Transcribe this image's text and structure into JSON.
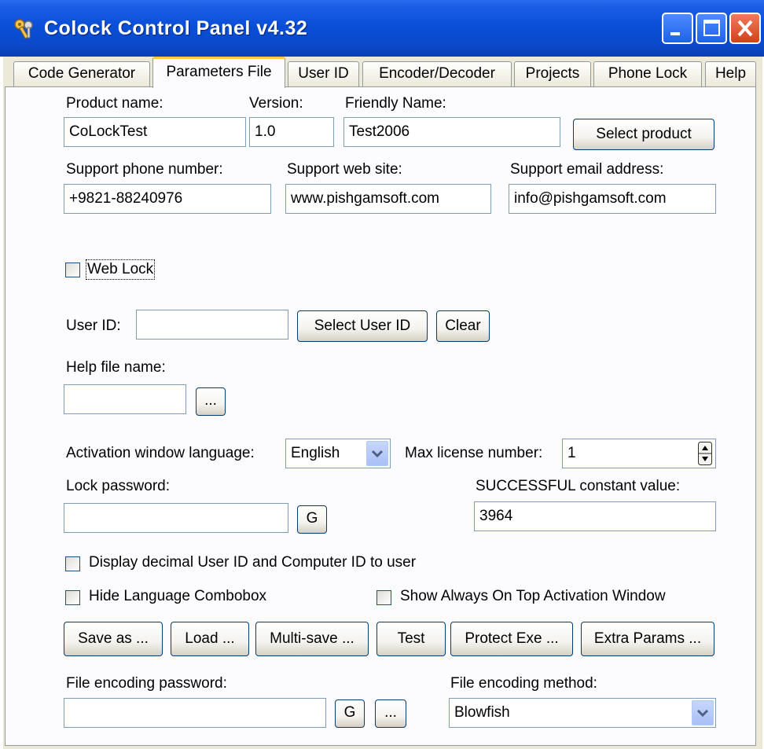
{
  "window": {
    "title": "Colock Control Panel v4.32",
    "title_icon": "keys-icon",
    "buttons": [
      "minimize",
      "maximize",
      "close"
    ],
    "titlebar_color": "#0a4fd8",
    "close_color": "#d2421c"
  },
  "tabs": [
    {
      "label": "Code Generator",
      "active": false
    },
    {
      "label": "Parameters File",
      "active": true
    },
    {
      "label": "User ID",
      "active": false
    },
    {
      "label": "Encoder/Decoder",
      "active": false
    },
    {
      "label": "Projects",
      "active": false
    },
    {
      "label": "Phone Lock",
      "active": false
    },
    {
      "label": "Help",
      "active": false
    }
  ],
  "form": {
    "product_name_label": "Product name:",
    "product_name": "CoLockTest",
    "version_label": "Version:",
    "version": "1.0",
    "friendly_name_label": "Friendly Name:",
    "friendly_name": "Test2006",
    "select_product": "Select product",
    "support_phone_label": "Support phone number:",
    "support_phone": "+9821-88240976",
    "support_web_label": "Support web site:",
    "support_web": "www.pishgamsoft.com",
    "support_email_label": "Support email address:",
    "support_email": "info@pishgamsoft.com",
    "web_lock_label": "Web Lock",
    "web_lock_checked": false,
    "user_id_label": "User ID:",
    "user_id": "",
    "select_user_id": "Select User ID",
    "clear": "Clear",
    "help_file_label": "Help file name:",
    "help_file": "",
    "browse": "...",
    "activation_lang_label": "Activation window language:",
    "activation_lang": "English",
    "max_license_label": "Max license number:",
    "max_license": "1",
    "lock_password_label": "Lock password:",
    "lock_password": "",
    "generate": "G",
    "successful_label": "SUCCESSFUL constant value:",
    "successful_value": "3964",
    "display_decimal_label": "Display decimal User ID and Computer ID to user",
    "hide_lang_label": "Hide Language Combobox",
    "always_on_top_label": "Show Always On Top Activation Window",
    "file_encoding_password_label": "File encoding password:",
    "file_encoding_password": "",
    "file_encoding_method_label": "File encoding method:",
    "file_encoding_method": "Blowfish"
  },
  "actions": {
    "save_as": "Save as ...",
    "load": "Load ...",
    "multi_save": "Multi-save ...",
    "test": "Test",
    "protect_exe": "Protect Exe ...",
    "extra_params": "Extra Params ..."
  }
}
